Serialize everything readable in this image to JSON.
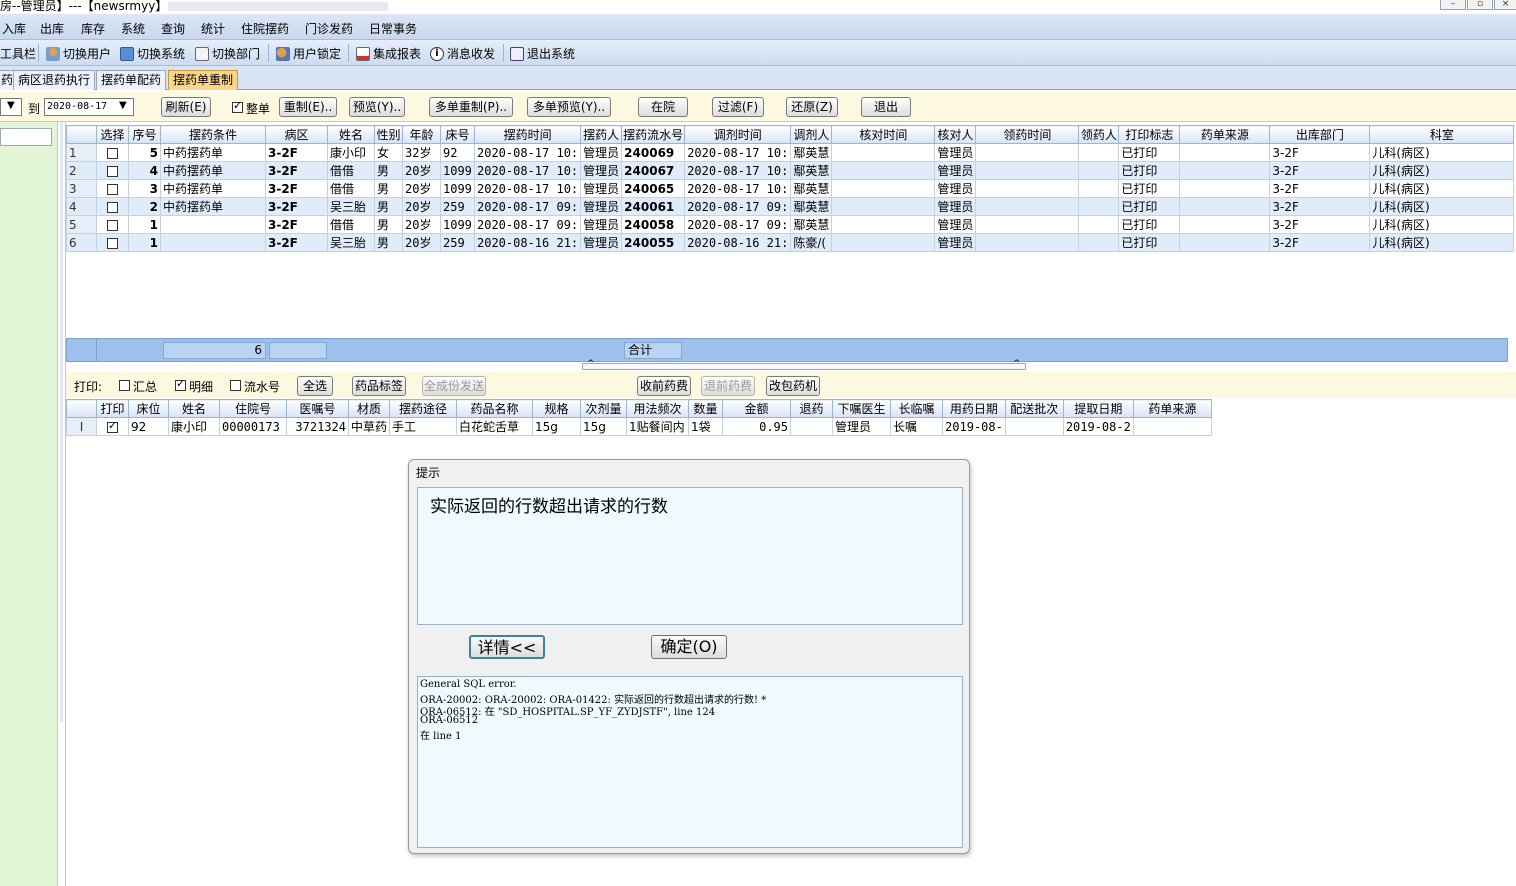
{
  "window": {
    "title": "房--管理员】---【newsrmyy】"
  },
  "menu": [
    "入库",
    "出库",
    "库存",
    "系统",
    "查询",
    "统计",
    "住院摆药",
    "门诊发药",
    "日常事务"
  ],
  "toolbar": {
    "label": "工具栏",
    "items": [
      {
        "label": "切换用户",
        "icon": "user-switch-icon"
      },
      {
        "label": "切换系统",
        "icon": "system-switch-icon"
      },
      {
        "label": "切换部门",
        "icon": "department-icon"
      },
      {
        "label": "用户锁定",
        "icon": "lock-icon"
      },
      {
        "label": "集成报表",
        "icon": "report-icon"
      },
      {
        "label": "消息收发",
        "icon": "info-icon"
      },
      {
        "label": "退出系统",
        "icon": "exit-icon"
      }
    ]
  },
  "tabs": [
    "药",
    "病区退药执行",
    "摆药单配药",
    "摆药单重制"
  ],
  "active_tab": "摆药单重制",
  "filter": {
    "to_label": "到",
    "date_to": "2020-08-17",
    "whole_label": "整单",
    "whole_checked": true,
    "buttons": [
      "刷新(E)",
      "重制(E)..",
      "预览(Y)..",
      "多单重制(P)..",
      "多单预览(Y)..",
      "在院",
      "过滤(F)",
      "还原(Z)",
      "退出"
    ]
  },
  "main_grid": {
    "columns": [
      "选择",
      "序号",
      "摆药条件",
      "病区",
      "姓名",
      "性别",
      "年龄",
      "床号",
      "摆药时间",
      "摆药人",
      "摆药流水号",
      "调剂时间",
      "调剂人",
      "核对时间",
      "核对人",
      "领药时间",
      "领药人",
      "打印标志",
      "药单来源",
      "出库部门",
      "科室"
    ],
    "rows": [
      {
        "idx": "1",
        "seq": "5",
        "cond": "中药摆药单",
        "ward": "3-2F",
        "name": "康小印",
        "sex": "女",
        "age": "32岁",
        "bed": "92",
        "time": "2020-08-17 10:",
        "user": "管理员",
        "serial": "240069",
        "disp_time": "2020-08-17 10:",
        "disp_user": "鄢英慧",
        "chk_time": "",
        "chk_user": "管理员",
        "take_time": "",
        "take_user": "",
        "print": "已打印",
        "source": "",
        "dept": "3-2F",
        "office": "儿科(病区)"
      },
      {
        "idx": "2",
        "seq": "4",
        "cond": "中药摆药单",
        "ward": "3-2F",
        "name": "借借",
        "sex": "男",
        "age": "20岁",
        "bed": "1099",
        "time": "2020-08-17 10:",
        "user": "管理员",
        "serial": "240067",
        "disp_time": "2020-08-17 10:",
        "disp_user": "鄢英慧",
        "chk_time": "",
        "chk_user": "管理员",
        "take_time": "",
        "take_user": "",
        "print": "已打印",
        "source": "",
        "dept": "3-2F",
        "office": "儿科(病区)"
      },
      {
        "idx": "3",
        "seq": "3",
        "cond": "中药摆药单",
        "ward": "3-2F",
        "name": "借借",
        "sex": "男",
        "age": "20岁",
        "bed": "1099",
        "time": "2020-08-17 10:",
        "user": "管理员",
        "serial": "240065",
        "disp_time": "2020-08-17 10:",
        "disp_user": "鄢英慧",
        "chk_time": "",
        "chk_user": "管理员",
        "take_time": "",
        "take_user": "",
        "print": "已打印",
        "source": "",
        "dept": "3-2F",
        "office": "儿科(病区)"
      },
      {
        "idx": "4",
        "seq": "2",
        "cond": "中药摆药单",
        "ward": "3-2F",
        "name": "吴三胎",
        "sex": "男",
        "age": "20岁",
        "bed": "259",
        "time": "2020-08-17 09:",
        "user": "管理员",
        "serial": "240061",
        "disp_time": "2020-08-17 09:",
        "disp_user": "鄢英慧",
        "chk_time": "",
        "chk_user": "管理员",
        "take_time": "",
        "take_user": "",
        "print": "已打印",
        "source": "",
        "dept": "3-2F",
        "office": "儿科(病区)"
      },
      {
        "idx": "5",
        "seq": "1",
        "cond": "",
        "ward": "3-2F",
        "name": "借借",
        "sex": "男",
        "age": "20岁",
        "bed": "1099",
        "time": "2020-08-17 09:",
        "user": "管理员",
        "serial": "240058",
        "disp_time": "2020-08-17 09:",
        "disp_user": "鄢英慧",
        "chk_time": "",
        "chk_user": "管理员",
        "take_time": "",
        "take_user": "",
        "print": "已打印",
        "source": "",
        "dept": "3-2F",
        "office": "儿科(病区)"
      },
      {
        "idx": "6",
        "seq": "1",
        "cond": "",
        "ward": "3-2F",
        "name": "吴三胎",
        "sex": "男",
        "age": "20岁",
        "bed": "259",
        "time": "2020-08-16 21:",
        "user": "管理员",
        "serial": "240055",
        "disp_time": "2020-08-16 21:",
        "disp_user": "陈豪/(",
        "chk_time": "",
        "chk_user": "管理员",
        "take_time": "",
        "take_user": "",
        "print": "已打印",
        "source": "",
        "dept": "3-2F",
        "office": "儿科(病区)"
      }
    ],
    "footer_count": "6",
    "footer_total_label": "合计"
  },
  "print_bar": {
    "print_label": "打印:",
    "summary_label": "汇总",
    "summary_checked": false,
    "detail_label": "明细",
    "detail_checked": true,
    "serial_label": "流水号",
    "serial_checked": false,
    "buttons": [
      "全选",
      "药品标签",
      "全成份发送",
      "收前药费",
      "退前药费",
      "改包药机"
    ]
  },
  "detail_grid": {
    "columns": [
      "打印",
      "床位",
      "姓名",
      "住院号",
      "医嘱号",
      "材质",
      "摆药途径",
      "药品名称",
      "规格",
      "次剂量",
      "用法频次",
      "数量",
      "金额",
      "退药",
      "下嘱医生",
      "长临嘱",
      "用药日期",
      "配送批次",
      "提取日期",
      "药单来源"
    ],
    "rows": [
      {
        "ind": "I",
        "checked": true,
        "bed": "92",
        "name": "康小印",
        "inpatient": "00000173",
        "order": "3721324",
        "material": "中草药",
        "route": "手工",
        "drug": "白花蛇舌草",
        "spec": "15g",
        "dose": "15g",
        "freq": "1贴餐间内",
        "qty": "1袋",
        "amount": "0.95",
        "refund": "",
        "doctor": "管理员",
        "long": "长嘱",
        "use_date": "2019-08-",
        "batch": "",
        "extract_date": "2019-08-2",
        "source": ""
      }
    ]
  },
  "dialog": {
    "title": "提示",
    "message": "实际返回的行数超出请求的行数",
    "details_button": "详情<<",
    "ok_button": "确定(O)",
    "detail_lines": [
      "General SQL error.",
      "ORA-20002: ORA-20002: ORA-01422: 实际返回的行数超出请求的行数! *",
      "ORA-06512: 在 \"SD_HOSPITAL.SP_YF_ZYDJSTF\", line 124",
      "ORA-06512",
      "在 line 1"
    ]
  }
}
